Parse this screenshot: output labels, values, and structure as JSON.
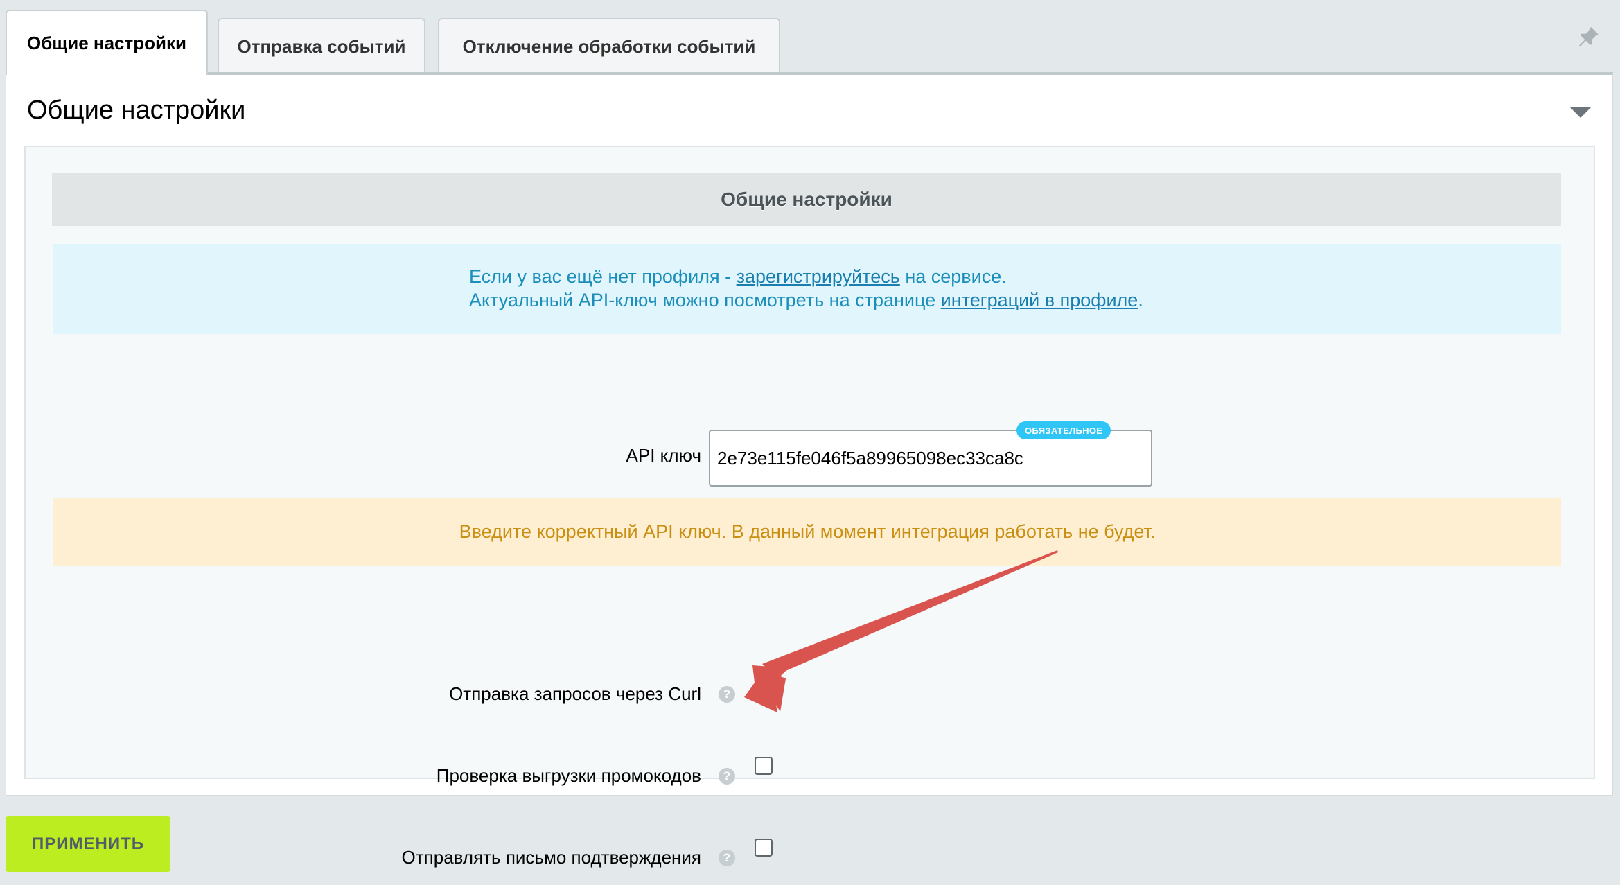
{
  "tabs": [
    {
      "label": "Общие настройки",
      "active": true
    },
    {
      "label": "Отправка событий",
      "active": false
    },
    {
      "label": "Отключение обработки событий",
      "active": false
    }
  ],
  "panel": {
    "title": "Общие настройки",
    "section_heading": "Общие настройки"
  },
  "info": {
    "line1_before": "Если у вас ещё нет профиля - ",
    "line1_link": "зарегистрируйтесь",
    "line1_after": " на сервисе.",
    "line2_before": "Актуальный API-ключ можно посмотреть на странице ",
    "line2_link": "интеграций в профиле",
    "line2_after": "."
  },
  "api_key": {
    "label": "API ключ",
    "value": "2e73e115fe046f5a89965098ec33ca8c",
    "badge": "ОБЯЗАТЕЛЬНОЕ"
  },
  "warning": "Введите корректный API ключ. В данный момент интеграция работать не будет.",
  "options": [
    {
      "label": "Отправка запросов через Curl",
      "checked": false
    },
    {
      "label": "Проверка выгрузки промокодов",
      "checked": false
    },
    {
      "label": "Отправлять письмо подтверждения",
      "checked": false
    }
  ],
  "help_glyph": "?",
  "apply_button": "ПРИМЕНИТЬ",
  "icons": {
    "pin": "pin-icon",
    "collapse": "collapse-triangle-icon",
    "help": "question-circle-icon"
  },
  "colors": {
    "accent_green": "#bbed21",
    "info_text": "#1b8ebc",
    "warning_text": "#ca8e10",
    "badge": "#2fc6f6",
    "annotation_arrow": "#d9534f"
  }
}
